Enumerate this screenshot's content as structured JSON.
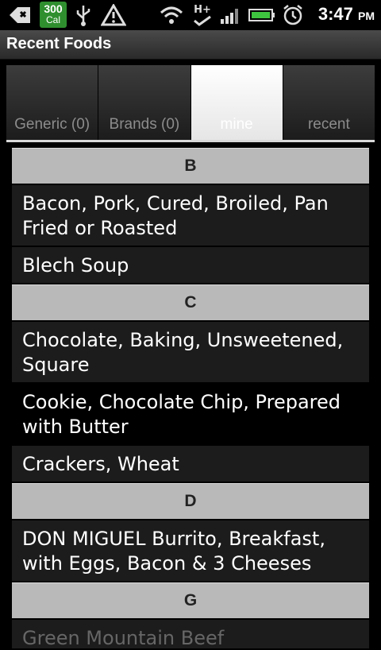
{
  "status_bar": {
    "calories_count": "300",
    "calories_label": "Cal",
    "time": "3:47",
    "ampm": "PM",
    "network_label": "H+"
  },
  "title": "Recent Foods",
  "tabs": [
    {
      "label": "Generic (0)",
      "active": false
    },
    {
      "label": "Brands (0)",
      "active": false
    },
    {
      "label": "mine",
      "active": true
    },
    {
      "label": "recent",
      "active": false
    }
  ],
  "list": {
    "section_b": "B",
    "item_bacon": "Bacon, Pork, Cured, Broiled, Pan Fried or Roasted",
    "item_blech": "Blech Soup",
    "section_c": "C",
    "item_chocolate": "Chocolate, Baking, Unsweetened, Square",
    "item_cookie": "Cookie, Chocolate Chip, Prepared with Butter",
    "item_crackers": "Crackers, Wheat",
    "section_d": "D",
    "item_don_miguel": "DON MIGUEL Burrito, Breakfast, with Eggs, Bacon & 3 Cheeses",
    "section_g": "G",
    "item_partial": "Green Mountain Beef"
  }
}
